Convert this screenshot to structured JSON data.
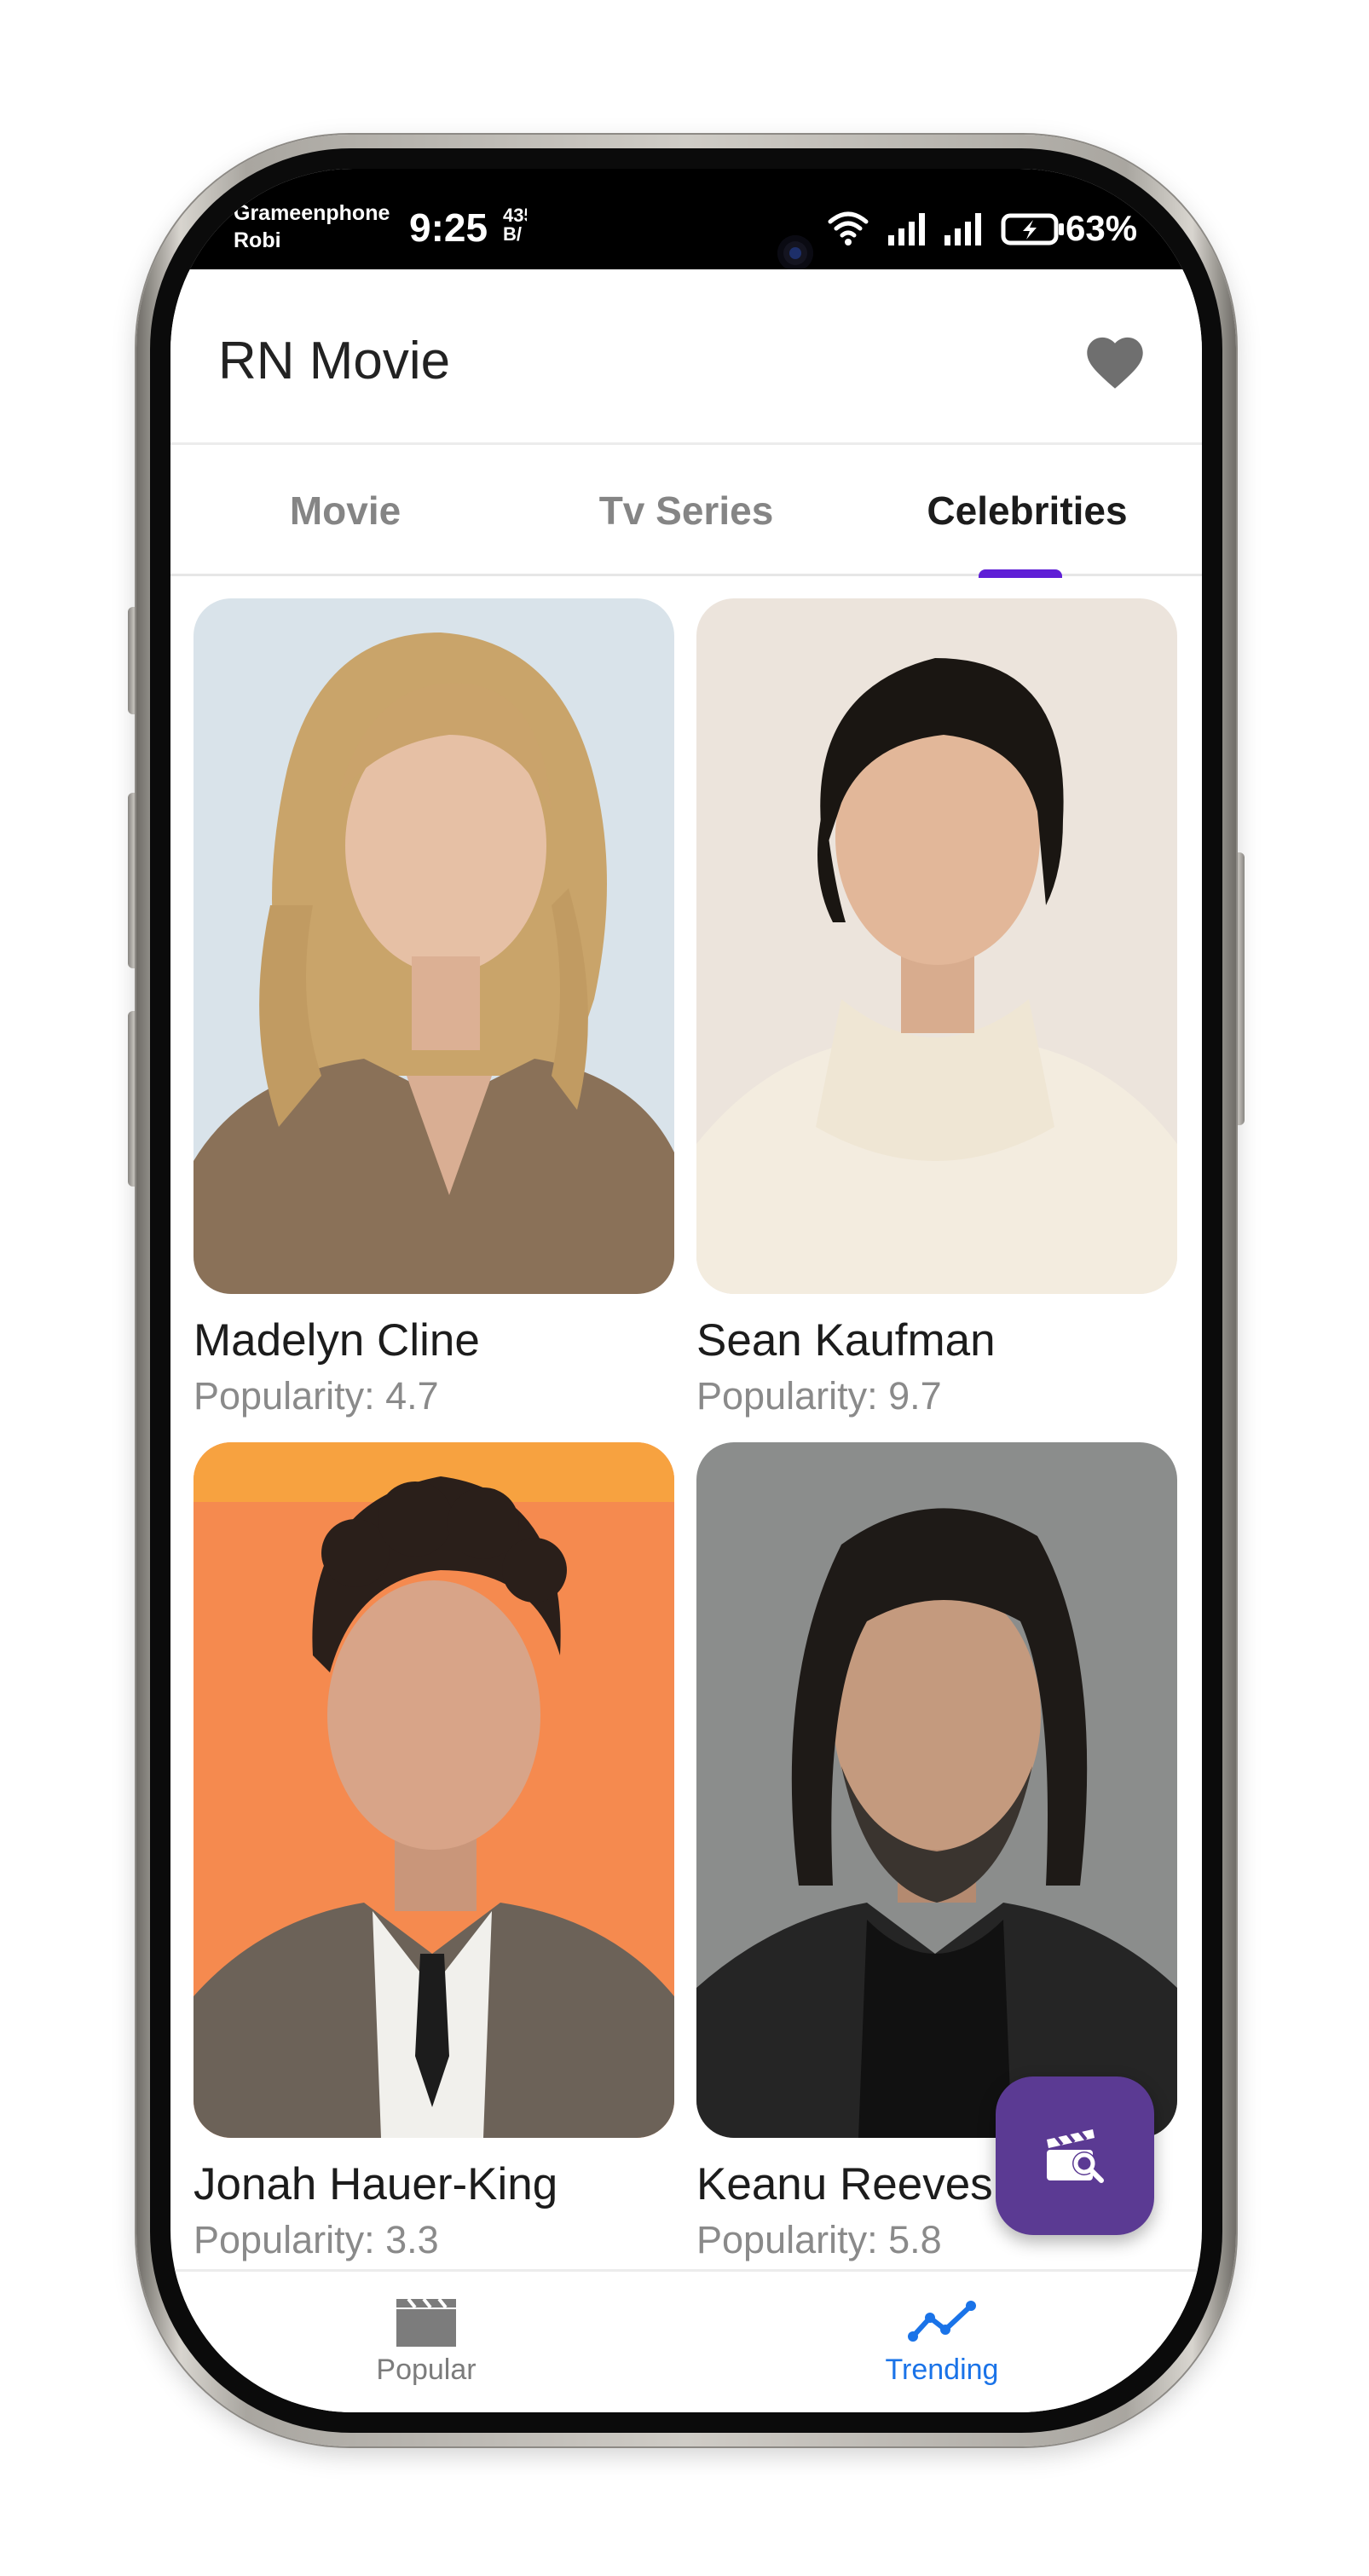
{
  "status_bar": {
    "carrier_1": "Grameenphone",
    "carrier_2": "Robi",
    "time": "9:25",
    "net_speed_value": "435",
    "net_speed_unit": "B/",
    "battery": "63%",
    "icons": [
      "wifi-icon",
      "signal-icon",
      "signal-icon",
      "battery-charging-icon"
    ]
  },
  "header": {
    "title": "RN Movie",
    "favorite_icon": "heart-icon"
  },
  "tabs": [
    {
      "label": "Movie",
      "active": false
    },
    {
      "label": "Tv Series",
      "active": false
    },
    {
      "label": "Celebrities",
      "active": true
    }
  ],
  "celebrities": [
    {
      "name": "Madelyn Cline",
      "popularity": "Popularity: 4.7"
    },
    {
      "name": "Sean Kaufman",
      "popularity": "Popularity: 9.7"
    },
    {
      "name": "Jonah Hauer-King",
      "popularity": "Popularity: 3.3"
    },
    {
      "name": "Keanu Reeves",
      "popularity": "Popularity: 5.8"
    }
  ],
  "fab": {
    "icon": "movie-search-icon"
  },
  "bottom_nav": [
    {
      "label": "Popular",
      "icon": "clapperboard-icon",
      "active": false
    },
    {
      "label": "Trending",
      "icon": "trending-icon",
      "active": true
    }
  ],
  "colors": {
    "accent": "#5f1fd6",
    "fab": "#5b3a93",
    "nav_active": "#1a73e8",
    "nav_inactive": "#7c7c7c"
  }
}
